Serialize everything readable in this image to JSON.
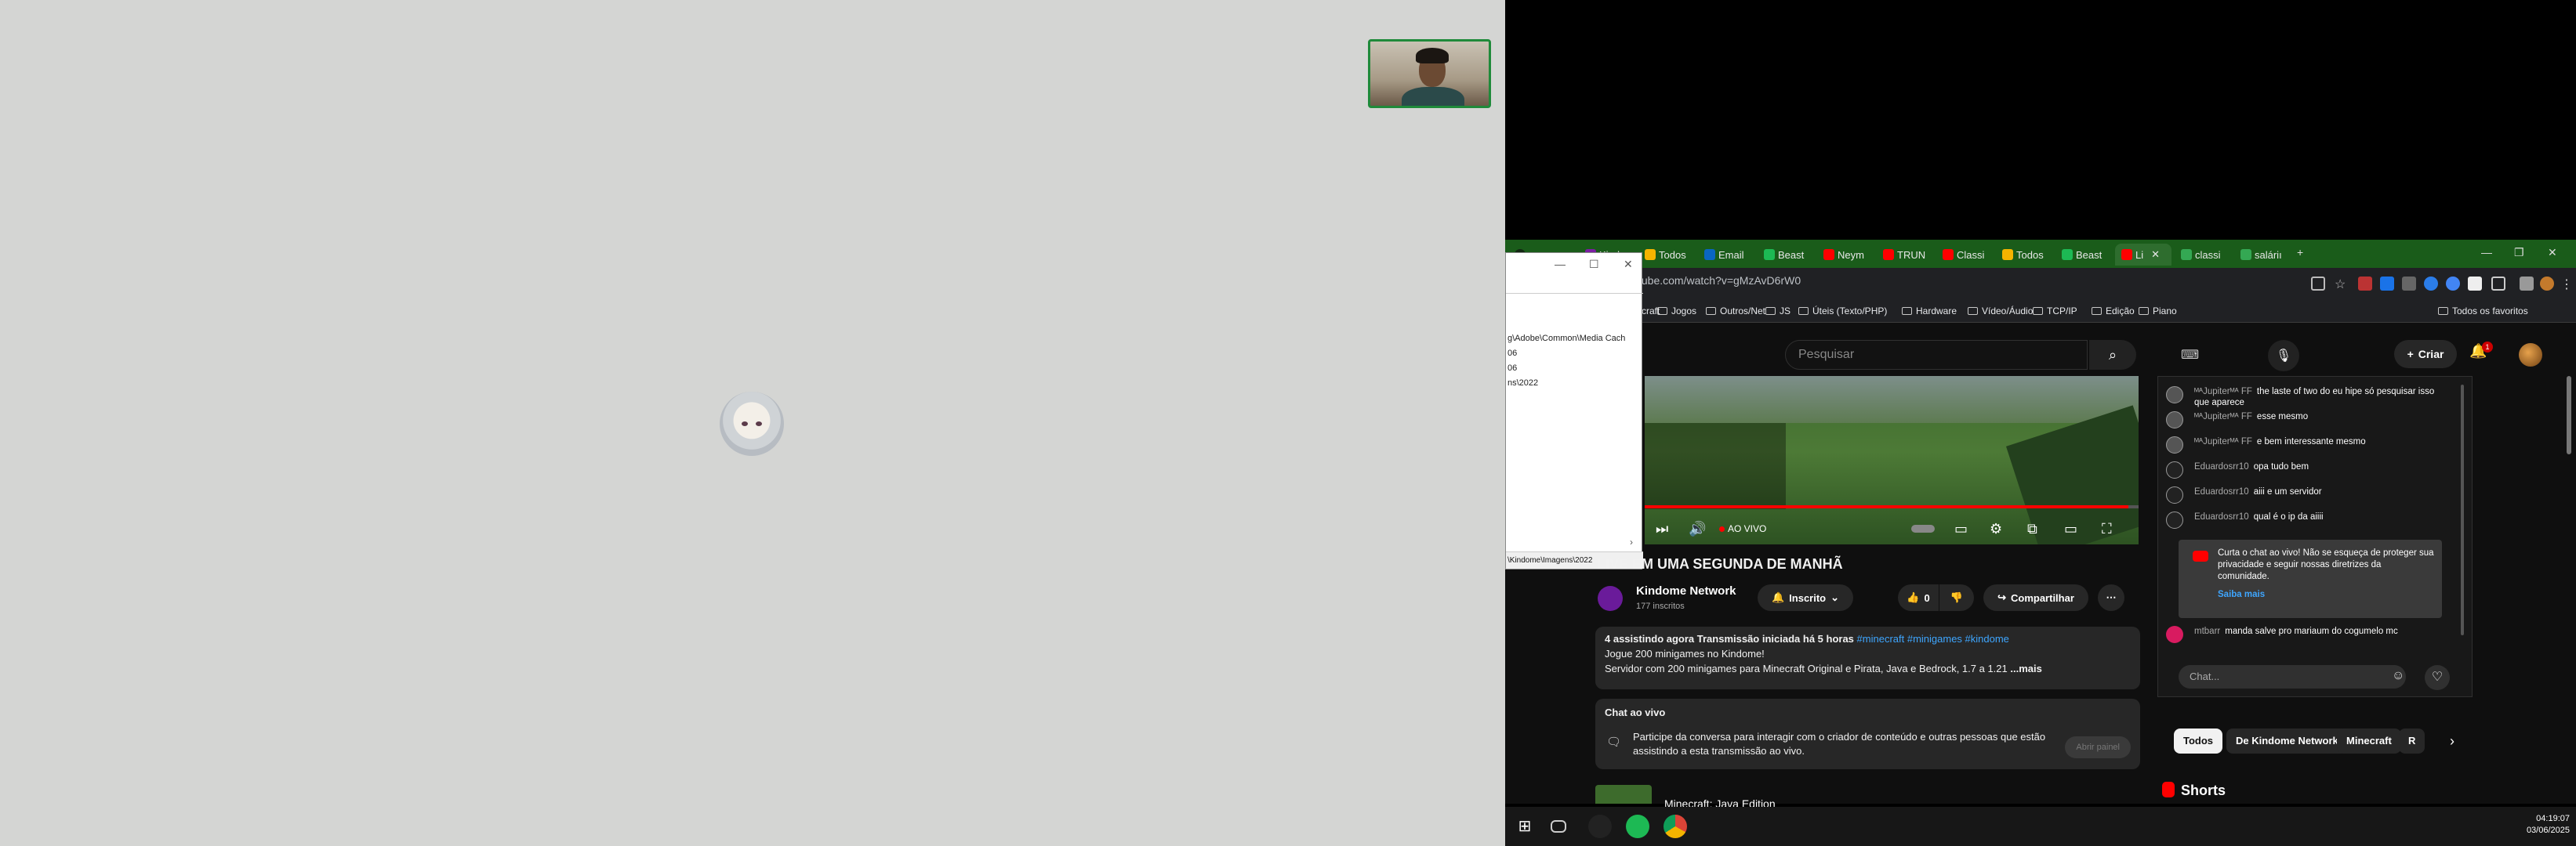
{
  "browser": {
    "tabs": [
      {
        "label": "Kindo",
        "color": "#7b1fa2"
      },
      {
        "label": "Todos",
        "color": "#f4b400"
      },
      {
        "label": "Email",
        "color": "#0a66c2"
      },
      {
        "label": "Beast",
        "color": "#1db954"
      },
      {
        "label": "Neym",
        "color": "#ff0000"
      },
      {
        "label": "TRUN",
        "color": "#ff0000"
      },
      {
        "label": "Classi",
        "color": "#ff0000"
      },
      {
        "label": "Todos",
        "color": "#f4b400"
      },
      {
        "label": "Beast",
        "color": "#1db954"
      },
      {
        "label": "Li",
        "color": "#ff0000",
        "active": true
      },
      {
        "label": "classi",
        "color": "#34a853"
      },
      {
        "label": "saláriı",
        "color": "#34a853"
      }
    ],
    "url": "tube.com/watch?v=gMzAvD6rW0",
    "bookmarks": [
      "Minecraft",
      "Jogos",
      "Outros/Net",
      "JS",
      "Úteis (Texto/PHP)",
      "Hardware",
      "Vídeo/Áudio",
      "TCP/IP",
      "Edição",
      "Piano"
    ],
    "all_bookmarks": "Todos os favoritos"
  },
  "explorer": {
    "lines": [
      "g\\Adobe\\Common\\Media Cach",
      "06",
      "06",
      "ns\\2022"
    ],
    "status": "\\Kindome\\Imagens\\2022"
  },
  "youtube": {
    "search_placeholder": "Pesquisar",
    "create_label": "Criar",
    "notif_count": "1",
    "player": {
      "live_label": "AO VIVO",
      "progress": 0.98
    },
    "video_title": "LIVE EM UMA SEGUNDA DE MANHÃ",
    "channel_name": "Kindome Network",
    "channel_subs": "177 inscritos",
    "subscribe_label": "Inscrito",
    "likes": "0",
    "share_label": "Compartilhar",
    "description": {
      "meta": "4 assistindo agora  Transmissão iniciada há 5 horas",
      "tags": "#minecraft #minigames #kindome",
      "line1": "Jogue 200 minigames no Kindome!",
      "line2": "Servidor com 200 minigames para Minecraft Original e Pirata, Java e Bedrock, 1.7 a 1.21",
      "more": "...mais"
    },
    "live_chat_box": {
      "heading": "Chat ao vivo",
      "text": "Participe da conversa para interagir com o criador de conteúdo e outras pessoas que estão assistindo a esta transmissão ao vivo.",
      "open_label": "Abrir painel"
    },
    "recommended_title": "Minecraft: Java Edition",
    "chat": {
      "messages": [
        {
          "author": "ᴹᴬJupiterᴹᴬ FF",
          "text": "the laste of two do eu hipe só pesquisar isso que aparece"
        },
        {
          "author": "ᴹᴬJupiterᴹᴬ FF",
          "text": "esse mesmo"
        },
        {
          "author": "ᴹᴬJupiterᴹᴬ FF",
          "text": "e bem interessante mesmo"
        },
        {
          "author": "Eduardosrr10",
          "text": "opa tudo bem"
        },
        {
          "author": "Eduardosrr10",
          "text": "aiii e um servidor"
        },
        {
          "author": "Eduardosrr10",
          "text": "qual é o ip da aiiii"
        }
      ],
      "notice_text": "Curta o chat ao vivo! Não se esqueça de proteger sua privacidade e seguir nossas diretrizes da comunidade.",
      "notice_link": "Saiba mais",
      "last_author": "mtbarr",
      "last_text": "manda salve pro mariaum do cogumelo mc",
      "input_placeholder": "Chat..."
    },
    "chips": [
      {
        "label": "Todos",
        "active": true
      },
      {
        "label": "De Kindome Network"
      },
      {
        "label": "Minecraft"
      },
      {
        "label": "R"
      }
    ],
    "shorts_label": "Shorts"
  },
  "taskbar": {
    "time": "04:19:07",
    "date": "03/06/2025"
  }
}
